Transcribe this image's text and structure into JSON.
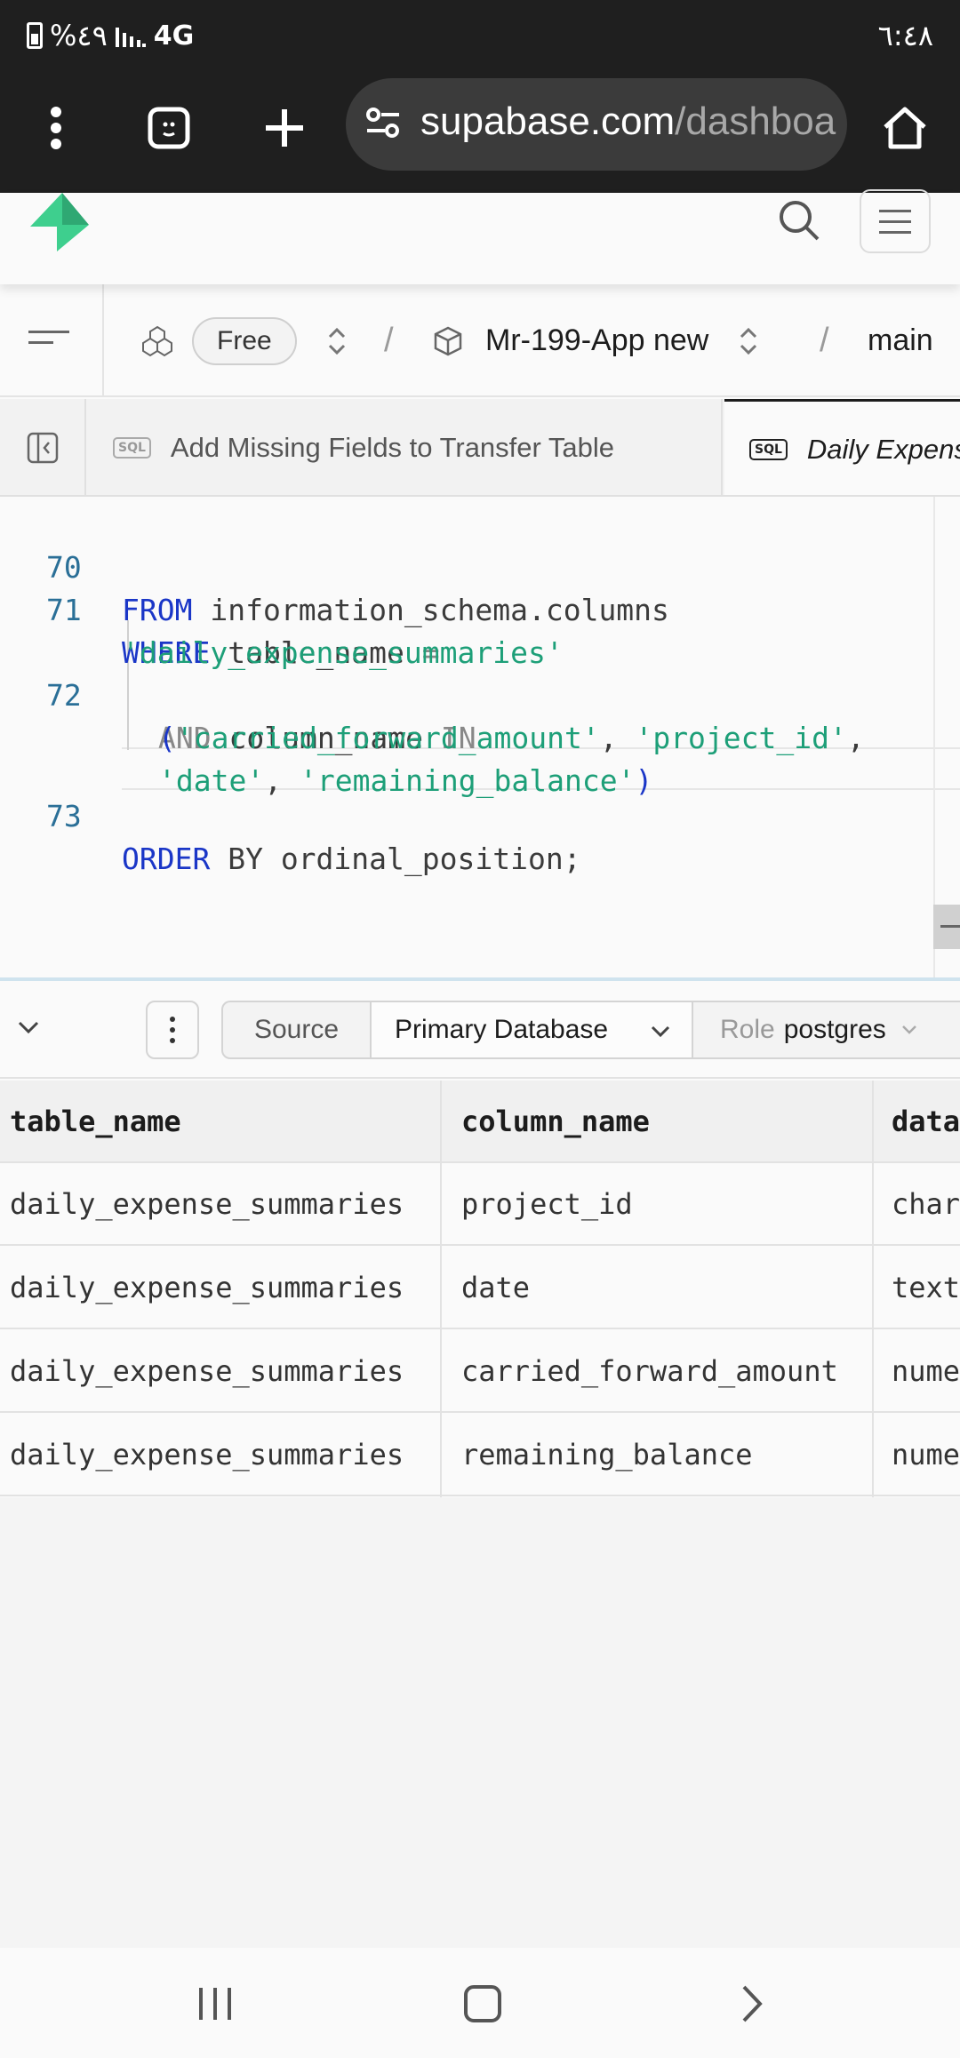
{
  "status_bar": {
    "battery_percent": "%٤٩",
    "network": "4G",
    "time": "٦:٤٨"
  },
  "browser": {
    "url_host": "supabase.com",
    "url_path": "/dashboa",
    "menu_icon": "more-vert-icon",
    "tabs_icon": "tab-switcher-icon",
    "new_tab_icon": "plus-icon",
    "home_icon": "home-icon"
  },
  "header": {
    "logo_icon": "supabase-bolt-icon",
    "brand_color": "#3ecf8e"
  },
  "breadcrumb": {
    "plan": "Free",
    "project": "Mr-199-App new",
    "branch": "main"
  },
  "tabs": [
    {
      "badge": "SQL",
      "label": "Add Missing Fields to Transfer Table"
    },
    {
      "badge": "SQL",
      "label": "Daily Expens"
    }
  ],
  "editor": {
    "line_numbers": [
      "70",
      "71",
      "72",
      "73"
    ],
    "line70": {
      "kw": "FROM",
      "rest": " information_schema.columns"
    },
    "line71": {
      "kw": "WHERE",
      "rest": " table_name ",
      "op": "=",
      "str": "'daily_expense_summaries'"
    },
    "line72": {
      "kw_and": "AND",
      "col": " column_name ",
      "kw_in": "IN",
      "open": "(",
      "s1": "'carried_forward_amount'",
      "comma1": ", ",
      "s2": "'project_id'",
      "comma2": ",",
      "s3": "'date'",
      "comma3": ", ",
      "s4": "'remaining_balance'",
      "close": ")"
    },
    "line73": {
      "kw_order": "ORDER",
      "rest": " BY ordinal_position;"
    }
  },
  "results_toolbar": {
    "source_label": "Source",
    "database": "Primary Database",
    "role_label": "Role",
    "role_value": "postgres"
  },
  "results": {
    "columns": [
      "table_name",
      "column_name",
      "data"
    ],
    "rows": [
      [
        "daily_expense_summaries",
        "project_id",
        "char"
      ],
      [
        "daily_expense_summaries",
        "date",
        "text"
      ],
      [
        "daily_expense_summaries",
        "carried_forward_amount",
        "nume"
      ],
      [
        "daily_expense_summaries",
        "remaining_balance",
        "nume"
      ]
    ]
  },
  "nav": {
    "recents_icon": "recents-icon",
    "home_icon": "home-square-icon",
    "back_icon": "chevron-right-icon"
  }
}
